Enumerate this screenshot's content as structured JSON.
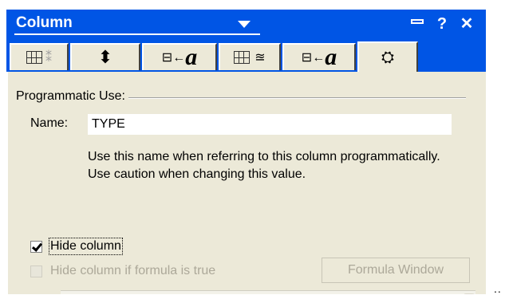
{
  "window": {
    "title": "Column"
  },
  "tabs": [
    {
      "icon": "column-layout-icon",
      "active": false
    },
    {
      "icon": "sort-icon",
      "active": false
    },
    {
      "icon": "text-format-icon",
      "glyph": "a",
      "active": false
    },
    {
      "icon": "column-header-icon",
      "active": false
    },
    {
      "icon": "header-text-format-icon",
      "glyph": "a",
      "active": false
    },
    {
      "icon": "advanced-settings-icon",
      "active": true
    }
  ],
  "section": {
    "label": "Programmatic Use:"
  },
  "name_field": {
    "label": "Name:",
    "value": "TYPE"
  },
  "help_text": "Use this name when referring to this column programmatically.  Use caution when changing this value.",
  "checkboxes": {
    "hide_column": {
      "label": "Hide column",
      "checked": true,
      "enabled": true
    },
    "hide_if_formula": {
      "label": "Hide column if formula is true",
      "checked": false,
      "enabled": false
    }
  },
  "buttons": {
    "formula_window": "Formula Window"
  },
  "overflow_indicator": ".."
}
